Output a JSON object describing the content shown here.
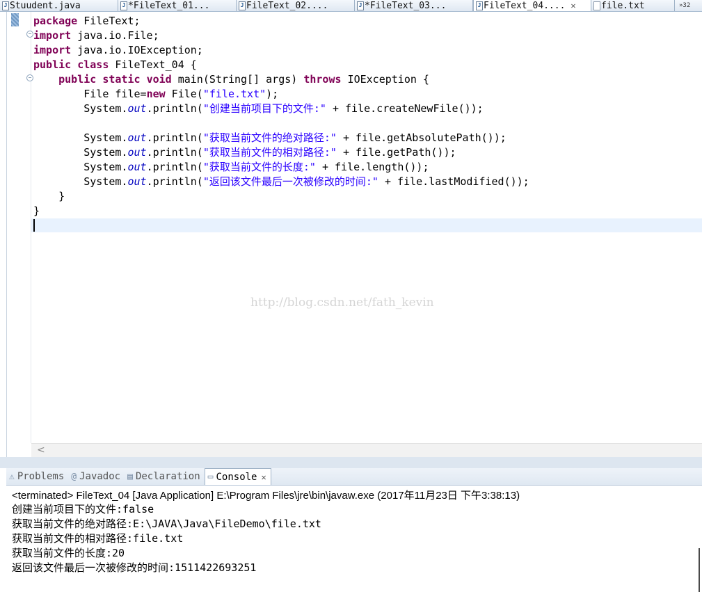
{
  "editor_tabs": [
    {
      "label": "Stuudent.java",
      "icon": "java-file-icon"
    },
    {
      "label": "*FileText_01...",
      "icon": "java-file-icon"
    },
    {
      "label": "FileText_02....",
      "icon": "java-file-icon"
    },
    {
      "label": "*FileText_03...",
      "icon": "java-file-icon"
    },
    {
      "label": "FileText_04....",
      "icon": "java-file-icon",
      "active": true,
      "close": "✕"
    },
    {
      "label": "file.txt",
      "icon": "text-file-icon"
    }
  ],
  "overflow_count": "»32",
  "code_lines": [
    [
      {
        "t": "package",
        "c": "kw"
      },
      {
        "t": " FileText;"
      }
    ],
    [
      {
        "t": "import",
        "c": "kw"
      },
      {
        "t": " java.io.File;"
      }
    ],
    [
      {
        "t": "import",
        "c": "kw"
      },
      {
        "t": " java.io.IOException;"
      }
    ],
    [
      {
        "t": "public",
        "c": "kw"
      },
      {
        "t": " "
      },
      {
        "t": "class",
        "c": "kw"
      },
      {
        "t": " FileText_04 {"
      }
    ],
    [
      {
        "t": "    "
      },
      {
        "t": "public",
        "c": "kw"
      },
      {
        "t": " "
      },
      {
        "t": "static",
        "c": "kw"
      },
      {
        "t": " "
      },
      {
        "t": "void",
        "c": "kw"
      },
      {
        "t": " main(String[] args) "
      },
      {
        "t": "throws",
        "c": "kw"
      },
      {
        "t": " IOException {"
      }
    ],
    [
      {
        "t": "        File file="
      },
      {
        "t": "new",
        "c": "kw"
      },
      {
        "t": " File("
      },
      {
        "t": "\"file.txt\"",
        "c": "str"
      },
      {
        "t": ");"
      }
    ],
    [
      {
        "t": "        System."
      },
      {
        "t": "out",
        "c": "fld"
      },
      {
        "t": ".println("
      },
      {
        "t": "\"创建当前项目下的文件:\"",
        "c": "str"
      },
      {
        "t": " + file.createNewFile());"
      }
    ],
    [
      {
        "t": ""
      }
    ],
    [
      {
        "t": "        System."
      },
      {
        "t": "out",
        "c": "fld"
      },
      {
        "t": ".println("
      },
      {
        "t": "\"获取当前文件的绝对路径:\"",
        "c": "str"
      },
      {
        "t": " + file.getAbsolutePath());"
      }
    ],
    [
      {
        "t": "        System."
      },
      {
        "t": "out",
        "c": "fld"
      },
      {
        "t": ".println("
      },
      {
        "t": "\"获取当前文件的相对路径:\"",
        "c": "str"
      },
      {
        "t": " + file.getPath());"
      }
    ],
    [
      {
        "t": "        System."
      },
      {
        "t": "out",
        "c": "fld"
      },
      {
        "t": ".println("
      },
      {
        "t": "\"获取当前文件的长度:\"",
        "c": "str"
      },
      {
        "t": " + file.length());"
      }
    ],
    [
      {
        "t": "        System."
      },
      {
        "t": "out",
        "c": "fld"
      },
      {
        "t": ".println("
      },
      {
        "t": "\"返回该文件最后一次被修改的时间:\"",
        "c": "str"
      },
      {
        "t": " + file.lastModified());"
      }
    ],
    [
      {
        "t": "    }"
      }
    ],
    [
      {
        "t": "}"
      }
    ]
  ],
  "watermark": "http://blog.csdn.net/fath_kevin",
  "scroll_left_glyph": "<",
  "view_tabs": [
    {
      "label": "Problems",
      "icon": "problems-icon",
      "glyph": "⚠"
    },
    {
      "label": "Javadoc",
      "icon": "javadoc-icon",
      "glyph": "@"
    },
    {
      "label": "Declaration",
      "icon": "declaration-icon",
      "glyph": "▤"
    },
    {
      "label": "Console",
      "icon": "console-icon",
      "glyph": "▭",
      "active": true,
      "close": "✕"
    }
  ],
  "console": {
    "header": "<terminated> FileText_04 [Java Application] E:\\Program Files\\jre\\bin\\javaw.exe (2017年11月23日 下午3:38:13)",
    "output": [
      "创建当前项目下的文件:false",
      "获取当前文件的绝对路径:E:\\JAVA\\Java\\FileDemo\\file.txt",
      "获取当前文件的相对路径:file.txt",
      "获取当前文件的长度:20",
      "返回该文件最后一次被修改的时间:1511422693251"
    ]
  },
  "colors": {
    "keyword": "#7f0055",
    "string": "#2a00ff",
    "field": "#0000c0",
    "current_line": "#e8f2fe"
  }
}
